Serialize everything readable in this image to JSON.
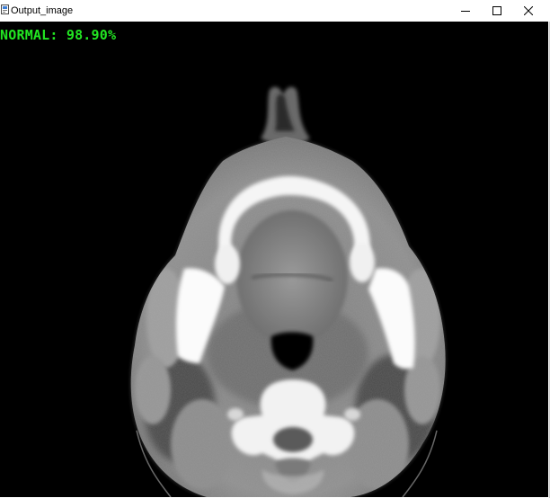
{
  "window": {
    "title": "Output_image",
    "controls": {
      "minimize_icon": "minimize-icon",
      "maximize_icon": "maximize-icon",
      "close_icon": "close-icon"
    }
  },
  "image": {
    "prediction_label": "NORMAL: 98.90%",
    "label_color": "#22e622",
    "content": "axial-ct-neck-scan"
  }
}
